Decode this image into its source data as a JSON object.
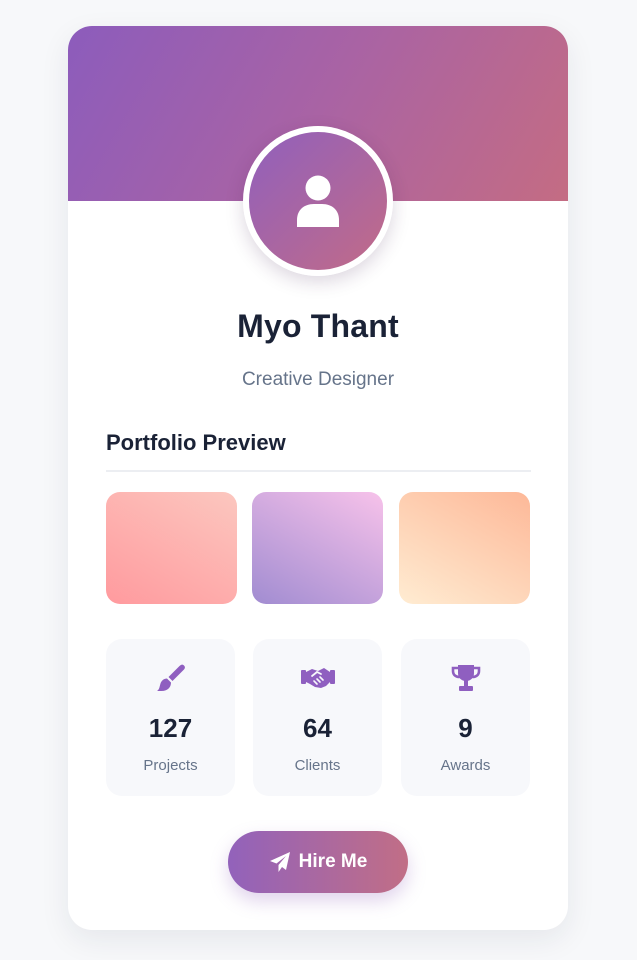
{
  "profile": {
    "name": "Myo Thant",
    "role": "Creative Designer"
  },
  "portfolio": {
    "title": "Portfolio Preview",
    "thumbnails": [
      {
        "gradient": [
          "#ff9a9e",
          "#fcc7bf"
        ]
      },
      {
        "gradient": [
          "#a18cd1",
          "#f7c2ea"
        ]
      },
      {
        "gradient": [
          "#ffecd2",
          "#fdb898"
        ]
      }
    ]
  },
  "stats": [
    {
      "icon": "paintbrush-icon",
      "value": "127",
      "label": "Projects"
    },
    {
      "icon": "handshake-icon",
      "value": "64",
      "label": "Clients"
    },
    {
      "icon": "trophy-icon",
      "value": "9",
      "label": "Awards"
    }
  ],
  "cta": {
    "icon": "paper-plane-icon",
    "label": "Hire Me"
  },
  "colors": {
    "accent": "#9262bb",
    "accent_end": "#c16e86",
    "text_primary": "#1a2236",
    "text_secondary": "#66748a"
  }
}
